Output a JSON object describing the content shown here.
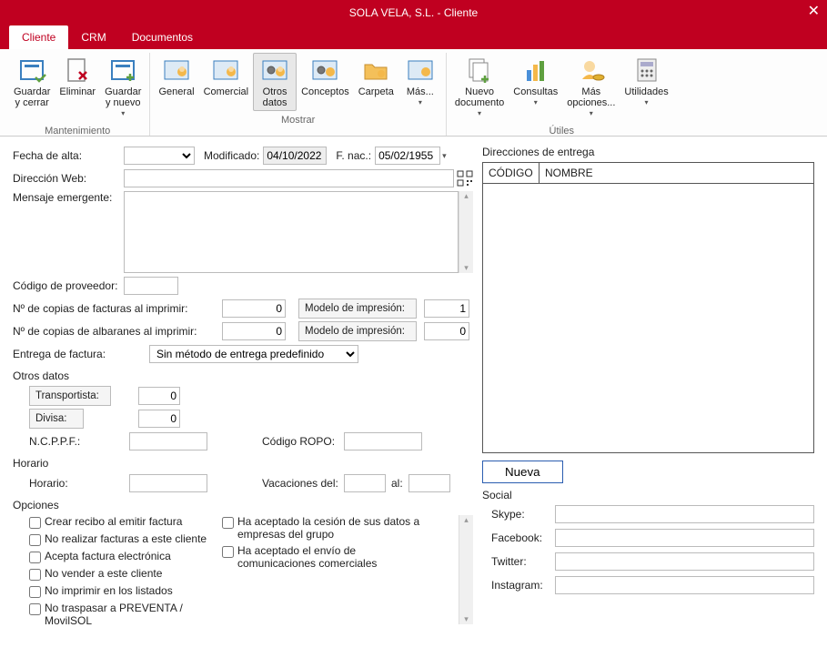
{
  "title": "SOLA VELA, S.L. - Cliente",
  "tabs": {
    "cliente": "Cliente",
    "crm": "CRM",
    "documentos": "Documentos"
  },
  "ribbon": {
    "guardar_cerrar": "Guardar\ny cerrar",
    "eliminar": "Eliminar",
    "guardar_nuevo": "Guardar\ny nuevo",
    "mantenimiento": "Mantenimiento",
    "general": "General",
    "comercial": "Comercial",
    "otros_datos": "Otros\ndatos",
    "conceptos": "Conceptos",
    "carpeta": "Carpeta",
    "mas": "Más...",
    "mostrar": "Mostrar",
    "nuevo_documento": "Nuevo\ndocumento",
    "consultas": "Consultas",
    "mas_opciones": "Más\nopciones...",
    "utilidades": "Utilidades",
    "utiles": "Útiles"
  },
  "form": {
    "fecha_alta_lbl": "Fecha de alta:",
    "fecha_alta_val": "",
    "modificado_lbl": "Modificado:",
    "modificado_val": "04/10/2022",
    "fnac_lbl": "F. nac.:",
    "fnac_val": "05/02/1955",
    "direccion_web_lbl": "Dirección Web:",
    "direccion_web_val": "",
    "mensaje_lbl": "Mensaje emergente:",
    "mensaje_val": "",
    "cod_prov_lbl": "Código de proveedor:",
    "cod_prov_val": "",
    "copias_fact_lbl": "Nº de copias de facturas al imprimir:",
    "copias_fact_val": "0",
    "modelo1_lbl": "Modelo de impresión:",
    "modelo1_val": "1",
    "copias_alb_lbl": "Nº de copias de albaranes al imprimir:",
    "copias_alb_val": "0",
    "modelo2_lbl": "Modelo de impresión:",
    "modelo2_val": "0",
    "entrega_lbl": "Entrega de factura:",
    "entrega_val": "Sin método de entrega predefinido",
    "otros_datos_sect": "Otros datos",
    "transportista_lbl": "Transportista:",
    "transportista_val": "0",
    "divisa_lbl": "Divisa:",
    "divisa_val": "0",
    "ncppf_lbl": "N.C.P.P.F.:",
    "ncppf_val": "",
    "ropo_lbl": "Código ROPO:",
    "ropo_val": "",
    "horario_sect": "Horario",
    "horario_lbl": "Horario:",
    "horario_val": "",
    "vacaciones_lbl": "Vacaciones del:",
    "vacaciones_del": "",
    "al_lbl": "al:",
    "vacaciones_al": "",
    "opciones_sect": "Opciones",
    "opt_recibo": "Crear recibo al emitir factura",
    "opt_no_facturas": "No realizar facturas a este cliente",
    "opt_efactura": "Acepta factura electrónica",
    "opt_no_vender": "No vender a este cliente",
    "opt_no_listados": "No imprimir en los listados",
    "opt_no_preventa": "No traspasar a PREVENTA / MovilSOL",
    "opt_cesion": "Ha aceptado la cesión de sus datos a empresas del grupo",
    "opt_comunic": "Ha aceptado el envío de comunicaciones comerciales"
  },
  "right": {
    "direcciones_lbl": "Direcciones de entrega",
    "th_codigo": "CÓDIGO",
    "th_nombre": "NOMBRE",
    "nueva_btn": "Nueva",
    "social_sect": "Social",
    "skype_lbl": "Skype:",
    "skype_val": "",
    "facebook_lbl": "Facebook:",
    "facebook_val": "",
    "twitter_lbl": "Twitter:",
    "twitter_val": "",
    "instagram_lbl": "Instagram:",
    "instagram_val": ""
  }
}
